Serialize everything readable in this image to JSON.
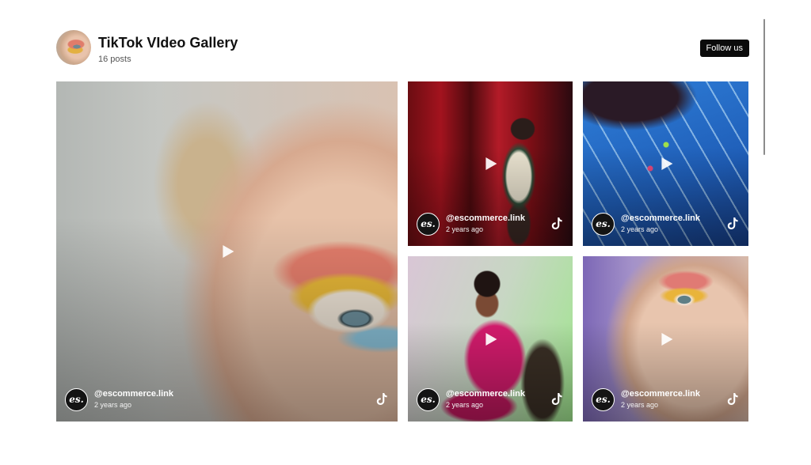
{
  "header": {
    "title": "TikTok VIdeo Gallery",
    "posts": "16 posts",
    "follow_label": "Follow us"
  },
  "cards": [
    {
      "handle": "@escommerce.link",
      "time": "2 years ago",
      "logo": "es."
    },
    {
      "handle": "@escommerce.link",
      "time": "2 years ago",
      "logo": "es."
    },
    {
      "handle": "@escommerce.link",
      "time": "2 years ago",
      "logo": "es."
    },
    {
      "handle": "@escommerce.link",
      "time": "2 years ago",
      "logo": "es."
    },
    {
      "handle": "@escommerce.link",
      "time": "2 years ago",
      "logo": "es."
    }
  ],
  "icons": [
    "play-icon",
    "tiktok-icon",
    "brand-logo"
  ],
  "colors": {
    "button_bg": "#0b0b0b",
    "text": "#111111",
    "overlay_text": "#ffffff"
  }
}
